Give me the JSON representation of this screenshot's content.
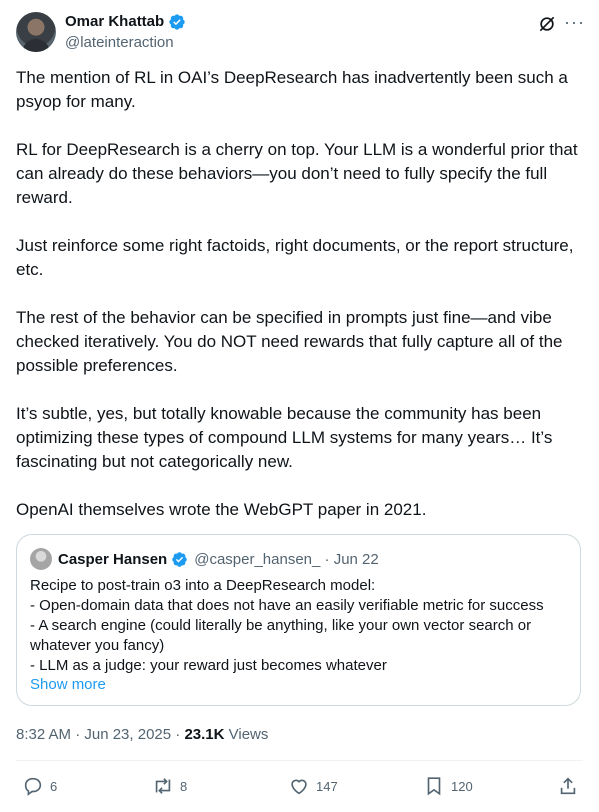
{
  "author": {
    "name": "Omar Khattab",
    "handle": "@lateinteraction",
    "verified": true
  },
  "icons": {
    "verified": "verified-badge-icon",
    "grok": "grok-icon",
    "more": "more-icon",
    "reply": "reply-icon",
    "retweet": "retweet-icon",
    "like": "like-icon",
    "bookmark": "bookmark-icon",
    "share": "share-icon"
  },
  "colors": {
    "accent": "#1d9bf0",
    "text": "#0f1419",
    "muted": "#536471",
    "border": "#cfd9de"
  },
  "tweet": {
    "paragraphs": [
      "The mention of RL in OAI’s DeepResearch has inadvertently been such a psyop for many.",
      "RL for DeepResearch is a cherry on top. Your LLM is a wonderful prior that can already do these behaviors—you don’t need to fully specify the full reward.",
      "Just reinforce some right factoids, right documents, or the report structure, etc.",
      "The rest of the behavior can be specified in prompts just fine—and vibe checked iteratively. You do NOT need rewards that fully capture all of the possible preferences.",
      "It’s subtle, yes, but totally knowable because the community has been optimizing these types of compound LLM systems for many years… It’s fascinating but not categorically new.",
      "OpenAI themselves wrote the WebGPT paper in 2021."
    ]
  },
  "quote": {
    "name": "Casper Hansen",
    "meta": "@casper_hansen_ · Jun 22",
    "lines": [
      "Recipe to post-train o3 into a DeepResearch model:",
      "- Open-domain data that does not have an easily verifiable metric for success",
      "- A search engine (could literally be anything, like your own vector search or whatever you fancy)",
      "- LLM as a judge: your reward just becomes whatever"
    ],
    "show_more": "Show more"
  },
  "meta": {
    "timestamp": "8:32 AM · Jun 23, 2025 · ",
    "views_count": "23.1K",
    "views_label": " Views"
  },
  "actions": {
    "replies": "6",
    "retweets": "8",
    "likes": "147",
    "bookmarks": "120"
  }
}
